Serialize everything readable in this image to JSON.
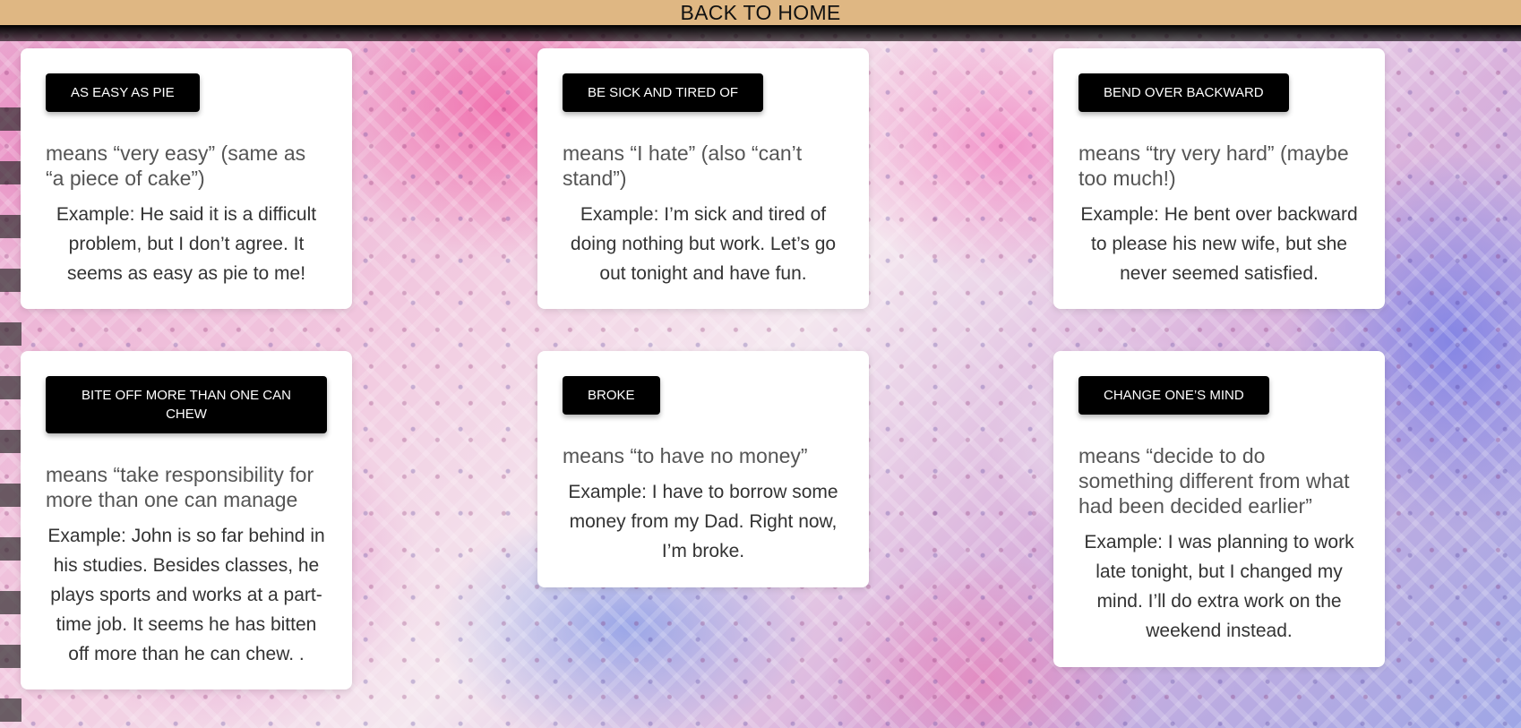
{
  "nav": {
    "back_label": "BACK TO HOME"
  },
  "colors": {
    "topbar": "#dfb783",
    "idiom_button": "#000000",
    "card": "#ffffff"
  },
  "cards": [
    {
      "idiom": "AS EASY AS PIE",
      "meaning": "means “very easy” (same as “a piece of cake”)",
      "example": "Example: He said it is a difficult problem, but I don’t agree. It seems as easy as pie to me!"
    },
    {
      "idiom": "BE SICK AND TIRED OF",
      "meaning": "means “I hate” (also “can’t stand”)",
      "example": "Example: I’m sick and tired of doing nothing but work. Let’s go out tonight and have fun."
    },
    {
      "idiom": "BEND OVER BACKWARD",
      "meaning": "means “try very hard” (maybe too much!)",
      "example": "Example: He bent over backward to please his new wife, but she never seemed satisfied."
    },
    {
      "idiom": "BITE OFF MORE THAN ONE CAN CHEW",
      "meaning": "means “take responsibility for more than one can manage",
      "example": "Example: John is so far behind in his studies. Besides classes, he plays sports and works at a part-time job. It seems he has bitten off more than he can chew. ."
    },
    {
      "idiom": "BROKE",
      "meaning": "means “to have no money”",
      "example": "Example: I have to borrow some money from my Dad. Right now, I’m broke."
    },
    {
      "idiom": "CHANGE ONE’S MIND",
      "meaning": "means “decide to do something different from what had been decided earlier”",
      "example": "Example: I was planning to work late tonight, but I changed my mind. I’ll do extra work on the weekend instead."
    }
  ]
}
